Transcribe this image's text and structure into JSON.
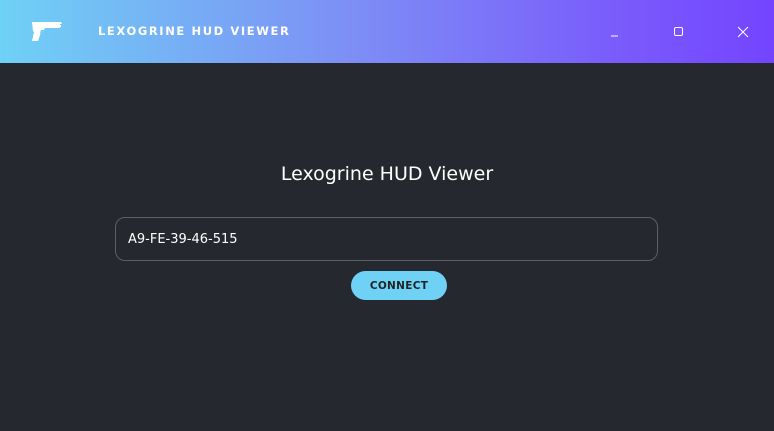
{
  "window": {
    "title": "LEXOGRINE HUD VIEWER",
    "logo_icon": "pistol-icon",
    "controls": {
      "minimize_icon": "minimize-icon",
      "maximize_icon": "maximize-icon",
      "close_icon": "close-icon"
    }
  },
  "main": {
    "heading": "Lexogrine HUD Viewer",
    "address_input": {
      "value": "A9-FE-39-46-515"
    },
    "connect_label": "CONNECT"
  },
  "colors": {
    "background": "#25282f",
    "titlebar_gradient_start": "#6fd1f5",
    "titlebar_gradient_end": "#7444ff",
    "accent": "#6fd1f3",
    "input_border": "#5b5f68"
  }
}
